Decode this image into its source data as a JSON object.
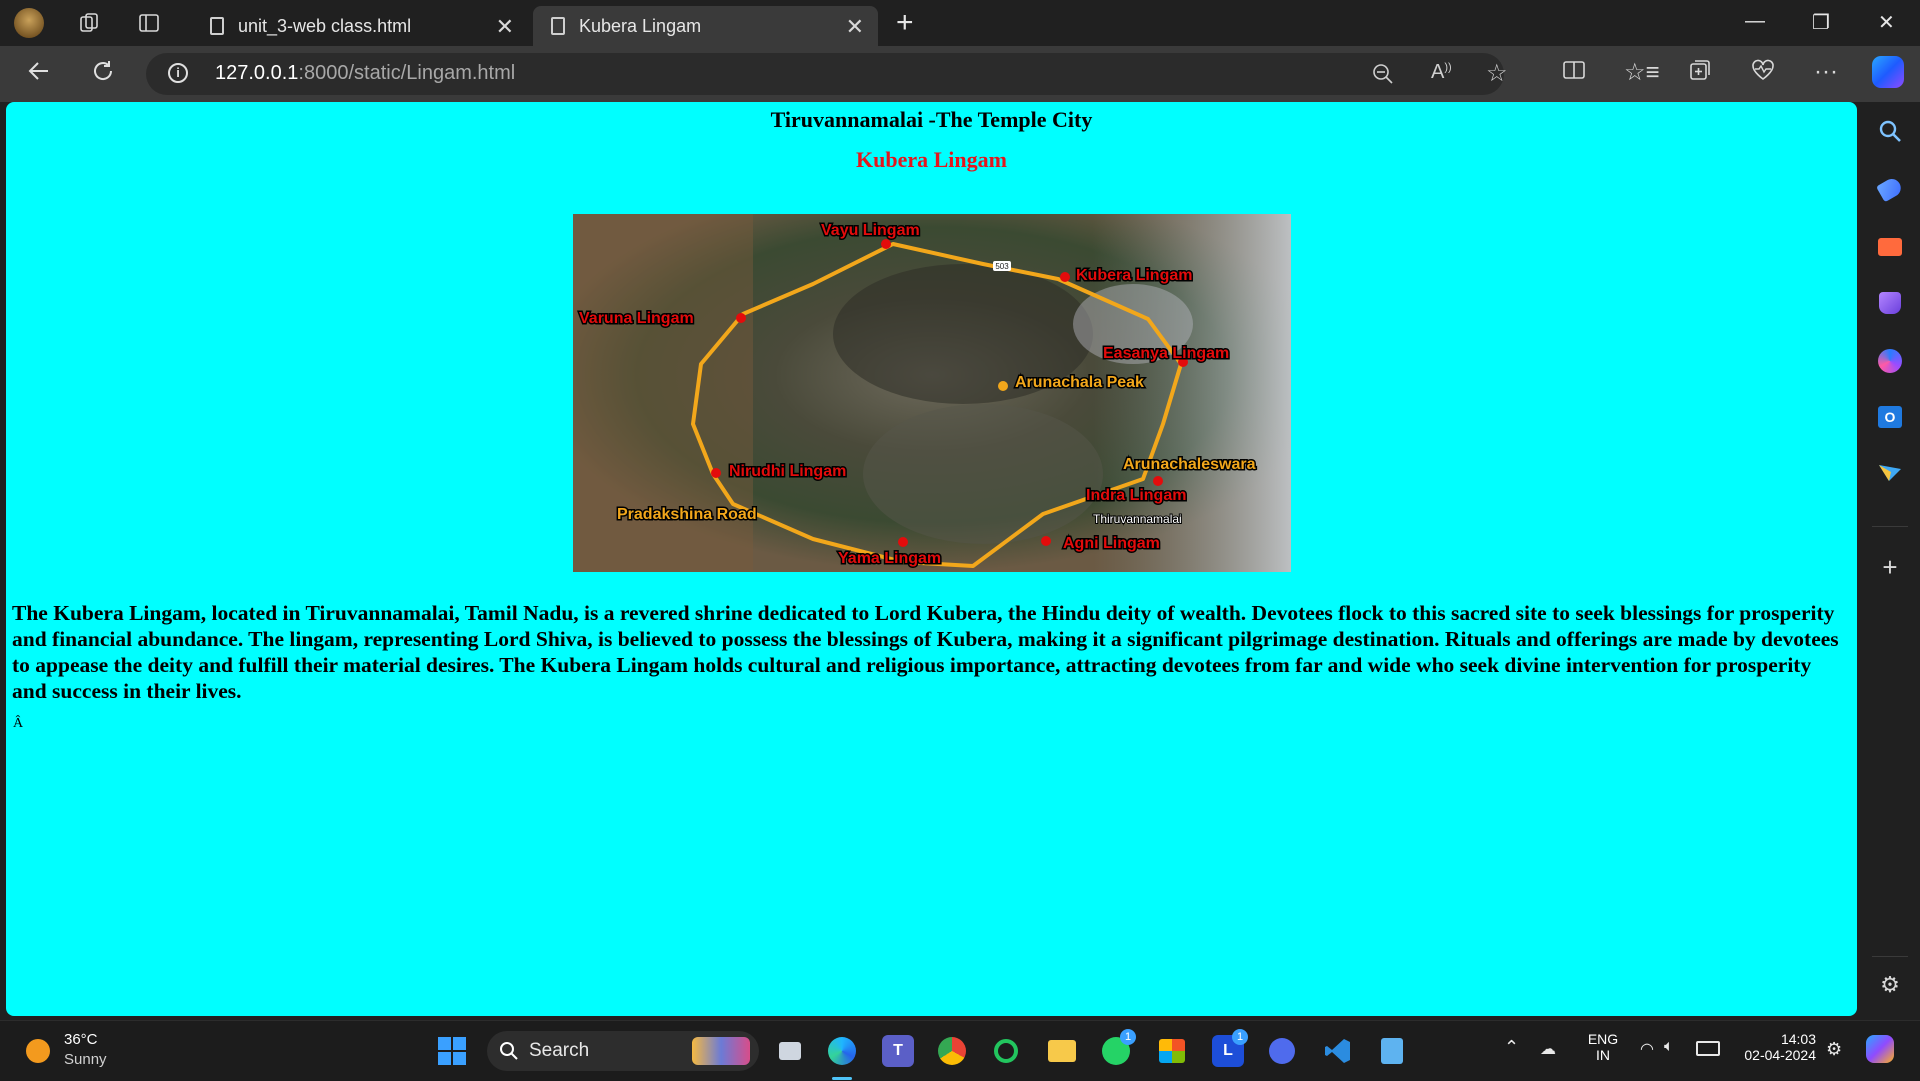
{
  "browser": {
    "tabs": [
      {
        "label": "unit_3-web class.html",
        "active": false
      },
      {
        "label": "Kubera Lingam",
        "active": true
      }
    ],
    "url_host": "127.0.0.1",
    "url_rest": ":8000/static/Lingam.html"
  },
  "page": {
    "title": "Tiruvannamalai -The Temple City",
    "subtitle": "Kubera Lingam",
    "map_labels": {
      "vayu": "Vayu Lingam",
      "kubera": "Kubera Lingam",
      "varuna": "Varuna Lingam",
      "easanya": "Easanya Lingam",
      "peak": "Arunachala Peak",
      "nirudhi": "Nirudhi Lingam",
      "arunachaleswara": "Arunachaleswara",
      "indra": "Indra Lingam",
      "pradakshina": "Pradakshina Road",
      "town": "Thiruvannamalai",
      "agni": "Agni Lingam",
      "yama": "Yama Lingam",
      "route": "503"
    },
    "description": "The Kubera Lingam, located in Tiruvannamalai, Tamil Nadu, is a revered shrine dedicated to Lord Kubera, the Hindu deity of wealth. Devotees flock to this sacred site to seek blessings for prosperity and financial abundance. The lingam, representing Lord Shiva, is believed to possess the blessings of Kubera, making it a significant pilgrimage destination. Rituals and offerings are made by devotees to appease the deity and fulfill their material desires. The Kubera Lingam holds cultural and religious importance, attracting devotees from far and wide who seek divine intervention for prosperity and success in their lives.",
    "stray_char": "Â",
    "background_color": "#00ffff",
    "accent_color": "#e4161d"
  },
  "taskbar": {
    "weather_temp": "36°C",
    "weather_desc": "Sunny",
    "search_label": "Search",
    "lang_top": "ENG",
    "lang_bottom": "IN",
    "time": "14:03",
    "date": "02-04-2024",
    "whatsapp_badge": "1",
    "launcher_badge": "1"
  }
}
